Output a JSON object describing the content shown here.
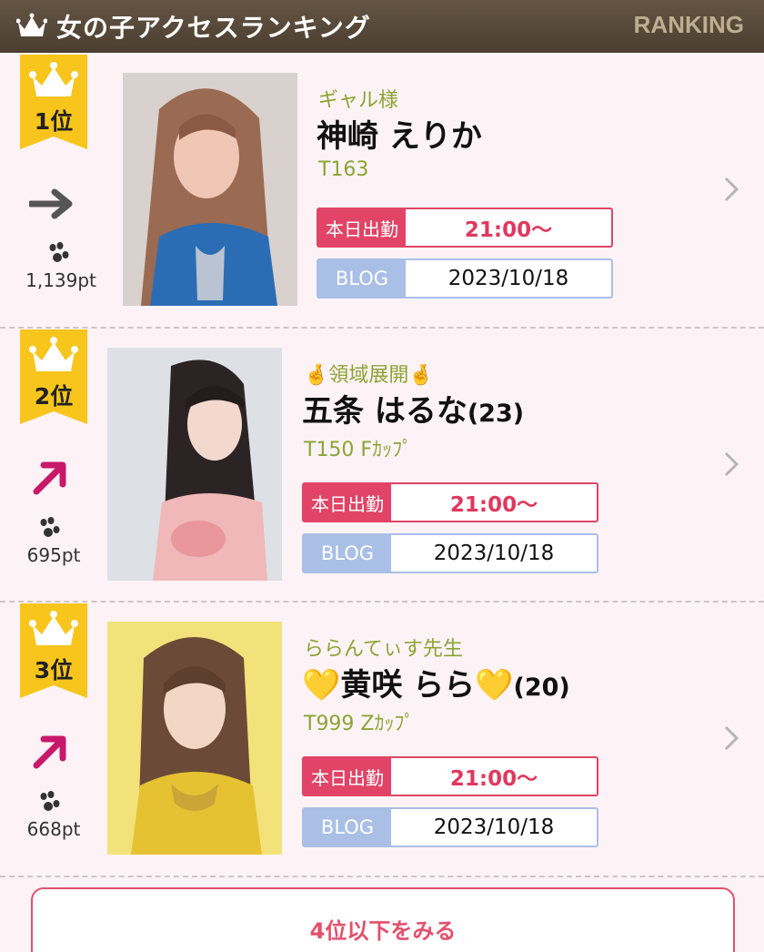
{
  "header": {
    "title": "女の子アクセスランキング",
    "subtitle": "RANKING"
  },
  "rankings": [
    {
      "rank": "1位",
      "trend": "right-arrow-icon",
      "points": "1,139pt",
      "catch": "ギャル様",
      "name": "神崎 えりか",
      "age": "",
      "spec": "T163",
      "schedule_label": "本日出勤",
      "schedule_time": "21:00〜",
      "blog_label": "BLOG",
      "blog_date": "2023/10/18"
    },
    {
      "rank": "2位",
      "trend": "up-right-arrow-icon",
      "points": "695pt",
      "catch": "🤞領域展開🤞",
      "name": "五条 はるな",
      "age": "(23)",
      "spec": "T150 Fｶｯﾌﾟ",
      "schedule_label": "本日出勤",
      "schedule_time": "21:00〜",
      "blog_label": "BLOG",
      "blog_date": "2023/10/18"
    },
    {
      "rank": "3位",
      "trend": "up-right-arrow-icon",
      "points": "668pt",
      "catch": "ららんてぃす先生",
      "name": "💛黄咲 らら💛",
      "age": "(20)",
      "spec": "T999 Zｶｯﾌﾟ",
      "schedule_label": "本日出勤",
      "schedule_time": "21:00〜",
      "blog_label": "BLOG",
      "blog_date": "2023/10/18"
    }
  ],
  "more_button": "4位以下をみる",
  "colors": {
    "header_bg": "#5a4b3b",
    "badge_gold": "#f7c51c",
    "catch_green": "#8aa435",
    "schedule_red": "#e14466",
    "blog_blue": "#a9bfe6",
    "trend_pink": "#c8186a",
    "trend_gray": "#555555"
  }
}
